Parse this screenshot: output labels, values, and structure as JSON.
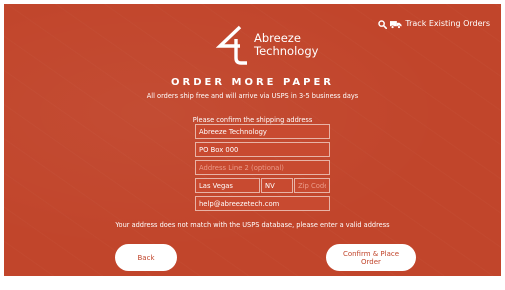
{
  "header": {
    "track_label": "Track Existing Orders",
    "track_icons": [
      "search-icon",
      "truck-icon"
    ]
  },
  "logo": {
    "line1": "Abreeze",
    "line2": "Technology"
  },
  "page": {
    "title": "ORDER MORE PAPER",
    "subtitle": "All orders ship free and will arrive via USPS in 3-5 business days",
    "confirm_label": "Please confirm the shipping address",
    "error_message": "Your address does not match with the USPS database, please enter a valid address"
  },
  "form": {
    "company": {
      "value": "Abreeze Technology",
      "placeholder": ""
    },
    "address1": {
      "value": "PO Box 000",
      "placeholder": ""
    },
    "address2": {
      "value": "",
      "placeholder": "Address Line 2 (optional)"
    },
    "city": {
      "value": "Las Vegas",
      "placeholder": ""
    },
    "state": {
      "value": "NV",
      "placeholder": ""
    },
    "zip": {
      "value": "",
      "placeholder": "Zip Code"
    },
    "email": {
      "value": "help@abreezetech.com",
      "placeholder": ""
    }
  },
  "buttons": {
    "back": "Back",
    "place_order": "Confirm & Place Order"
  },
  "colors": {
    "background": "#c1452b",
    "field_border": "#e8b3a6",
    "button_bg": "#ffffff",
    "button_text": "#c1452b"
  }
}
